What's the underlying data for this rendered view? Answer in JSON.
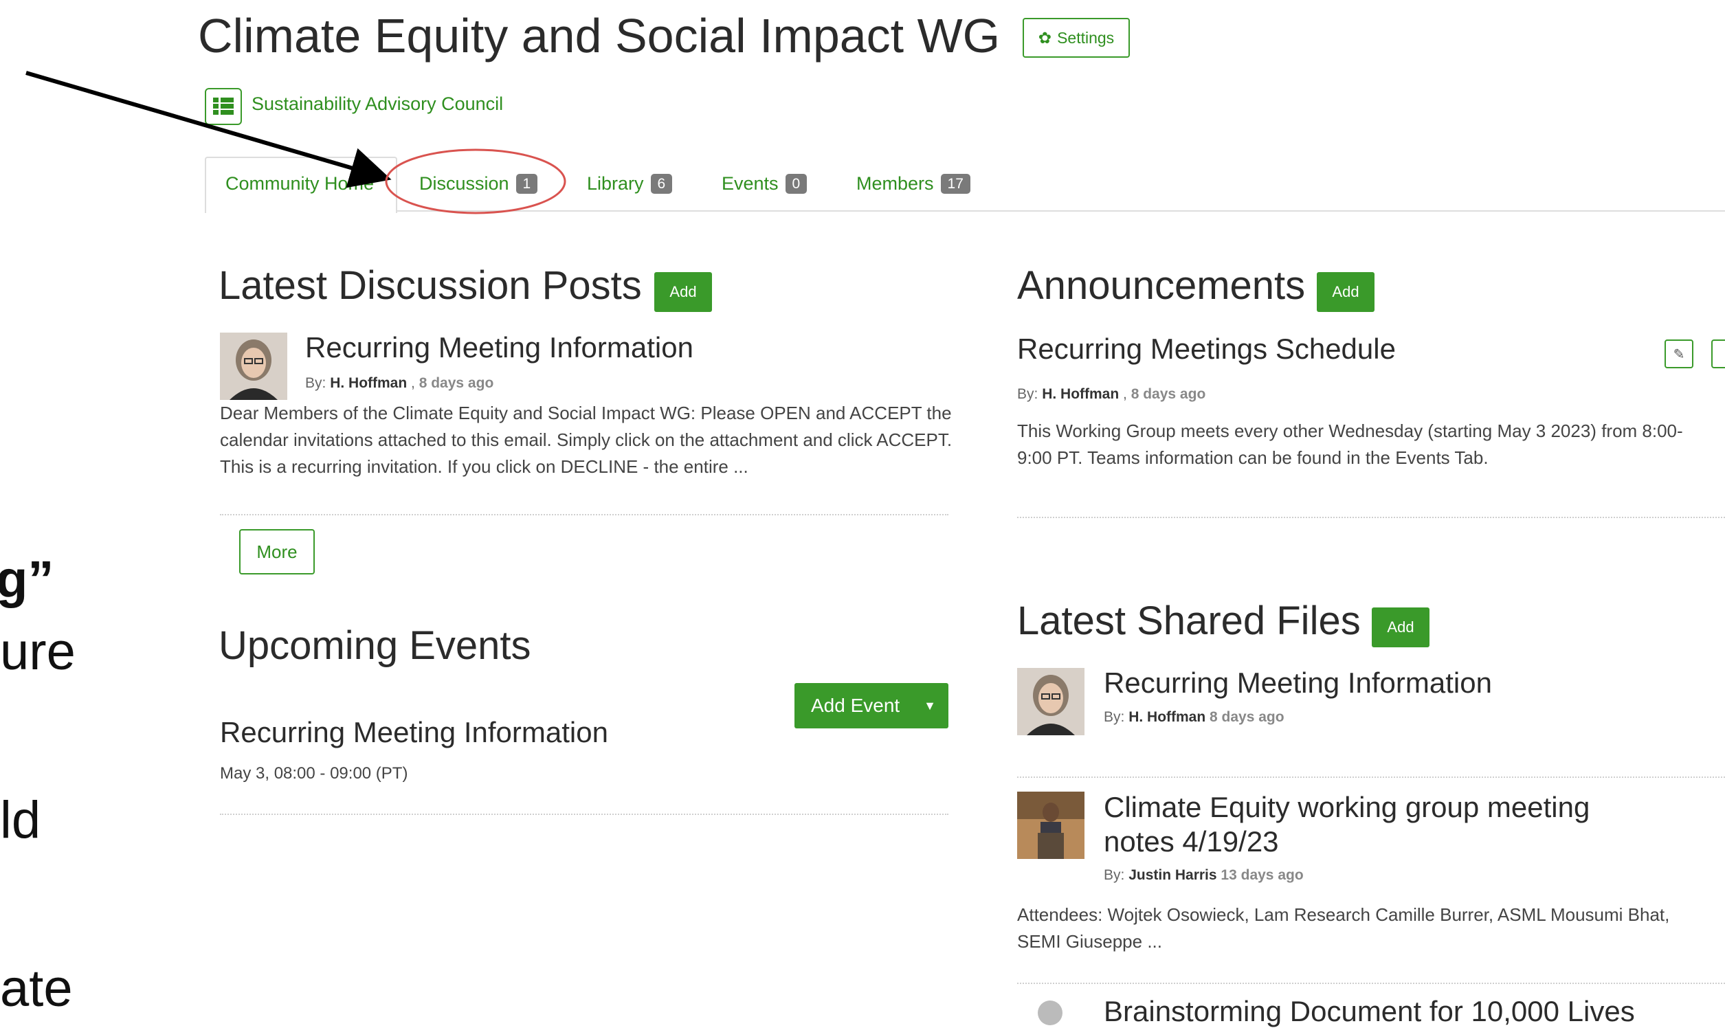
{
  "page": {
    "title": "Climate Equity and Social Impact WG",
    "settings_label": "Settings",
    "parent_link": "Sustainability Advisory Council"
  },
  "tabs": [
    {
      "label": "Community Home"
    },
    {
      "label": "Discussion",
      "count": "1"
    },
    {
      "label": "Library",
      "count": "6"
    },
    {
      "label": "Events",
      "count": "0"
    },
    {
      "label": "Members",
      "count": "17"
    }
  ],
  "discussion": {
    "heading": "Latest Discussion Posts",
    "add_label": "Add",
    "post": {
      "title": "Recurring Meeting Information",
      "by_prefix": "By:",
      "author": "H. Hoffman",
      "separator": ",",
      "ago": "8 days ago",
      "body": "Dear Members of the Climate Equity and Social Impact WG: Please OPEN and ACCEPT the calendar invitations attached to this email. Simply click on the attachment and click ACCEPT. This is a recurring invitation. If you click on DECLINE - the entire ..."
    },
    "more_label": "More"
  },
  "events": {
    "heading": "Upcoming Events",
    "add_event_label": "Add Event",
    "event": {
      "title": "Recurring Meeting Information",
      "when": "May 3, 08:00 - 09:00 (PT)"
    }
  },
  "announcements": {
    "heading": "Announcements",
    "add_label": "Add",
    "item": {
      "title": "Recurring Meetings Schedule",
      "by_prefix": "By:",
      "author": "H. Hoffman",
      "separator": ",",
      "ago": "8 days ago",
      "body": "This Working Group meets every other Wednesday (starting May 3 2023) from 8:00-9:00 PT.  Teams information can be found in the Events Tab."
    }
  },
  "files": {
    "heading": "Latest Shared Files",
    "add_label": "Add",
    "items": [
      {
        "title": "Recurring Meeting Information",
        "by_prefix": "By:",
        "author": "H. Hoffman",
        "ago": "8 days ago"
      },
      {
        "title_line1": "Climate Equity working group meeting",
        "title_line2": "notes 4/19/23",
        "by_prefix": "By:",
        "author": "Justin Harris",
        "ago": "13 days ago",
        "body": "Attendees: Wojtek Osowieck, Lam Research Camille Burrer, ASML Mousumi Bhat, SEMI Giuseppe ..."
      },
      {
        "title": "Brainstorming Document for 10,000 Lives"
      }
    ]
  },
  "side_fragments": [
    "g”",
    "ure",
    "ld",
    "ate"
  ],
  "colors": {
    "accent": "#3a9a2a",
    "annotation": "#d9534f",
    "badge": "#7a7a7a"
  }
}
